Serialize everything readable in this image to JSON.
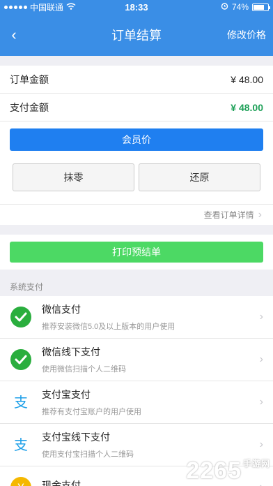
{
  "status": {
    "carrier": "中国联通",
    "time": "18:33",
    "battery": "74%",
    "battery_level": 0.74
  },
  "nav": {
    "back_icon": "‹",
    "title": "订单结算",
    "action": "修改价格"
  },
  "summary": {
    "order_amount_label": "订单金额",
    "order_amount_value": "¥ 48.00",
    "pay_amount_label": "支付金额",
    "pay_amount_value": "¥ 48.00"
  },
  "buttons": {
    "member_price": "会员价",
    "round_off": "抹零",
    "restore": "还原",
    "view_details": "查看订单详情",
    "print_pre": "打印预结单"
  },
  "section_label": "系统支付",
  "payments": [
    {
      "name": "微信支付",
      "desc": "推荐安装微信5.0及以上版本的用户使用",
      "icon": "wechat-icon"
    },
    {
      "name": "微信线下支付",
      "desc": "使用微信扫描个人二维码",
      "icon": "wechat-icon"
    },
    {
      "name": "支付宝支付",
      "desc": "推荐有支付宝账户的用户使用",
      "icon": "alipay-icon"
    },
    {
      "name": "支付宝线下支付",
      "desc": "使用支付宝扫描个人二维码",
      "icon": "alipay-icon"
    },
    {
      "name": "现金支付",
      "desc": "",
      "icon": "cash-icon"
    }
  ],
  "watermark": {
    "main": "2265",
    "sub": "手游网"
  },
  "colors": {
    "primary": "#3a8ee6",
    "blue_button": "#1f7ff0",
    "green_button": "#4cd964",
    "amount_green": "#1ea058"
  }
}
